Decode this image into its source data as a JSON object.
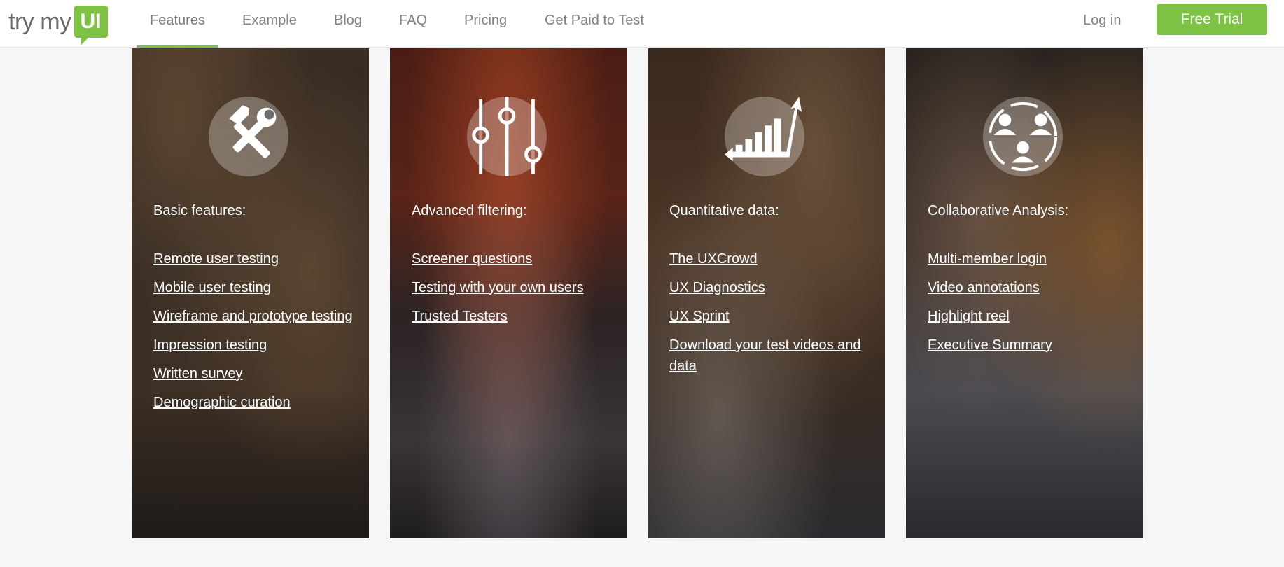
{
  "header": {
    "logo_text": "try my",
    "logo_badge": "UI",
    "nav": [
      "Features",
      "Example",
      "Blog",
      "FAQ",
      "Pricing",
      "Get Paid to Test"
    ],
    "login": "Log in",
    "cta": "Free Trial",
    "accent_color": "#7dc242"
  },
  "cards": [
    {
      "heading": "Basic features:",
      "icon": "tools-icon",
      "links": [
        "Remote user testing",
        "Mobile user testing",
        "Wireframe and prototype testing",
        "Impression testing",
        "Written survey",
        "Demographic curation"
      ]
    },
    {
      "heading": "Advanced filtering:",
      "icon": "sliders-icon",
      "links": [
        "Screener questions",
        "Testing with your own users",
        "Trusted Testers"
      ]
    },
    {
      "heading": "Quantitative data:",
      "icon": "growth-chart-icon",
      "links": [
        "The UXCrowd",
        "UX Diagnostics",
        "UX Sprint",
        "Download your test videos and data"
      ]
    },
    {
      "heading": "Collaborative Analysis:",
      "icon": "team-icon",
      "links": [
        "Multi-member login",
        "Video annotations",
        "Highlight reel",
        "Executive Summary"
      ]
    }
  ]
}
